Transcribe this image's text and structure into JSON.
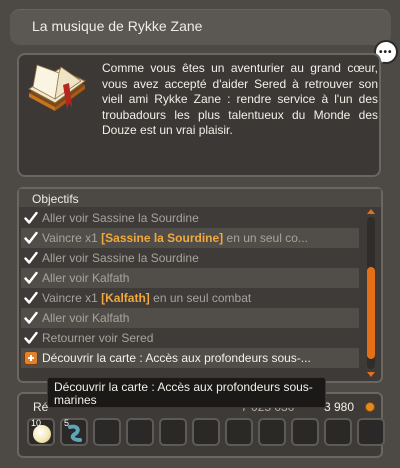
{
  "quest": {
    "title": "La musique de Rykke Zane",
    "description": "Comme vous êtes un aventurier au grand cœur, vous avez accepté d'aider Sered à retrouver son vieil ami Rykke Zane : rendre service à l'un des troubadours les plus talentueux du Monde des Douze est un vrai plaisir."
  },
  "objectives": {
    "header": "Objectifs",
    "items": [
      {
        "before": "Aller voir Sassine la Sourdine",
        "highlight": "",
        "after": "",
        "done": true
      },
      {
        "before": "Vaincre x1 ",
        "highlight": "[Sassine la Sourdine]",
        "after": " en un seul co...",
        "done": true
      },
      {
        "before": "Aller voir Sassine la Sourdine",
        "highlight": "",
        "after": "",
        "done": true
      },
      {
        "before": "Aller voir Kalfath",
        "highlight": "",
        "after": "",
        "done": true
      },
      {
        "before": "Vaincre x1 ",
        "highlight": "[Kalfath]",
        "after": " en un seul combat",
        "done": true
      },
      {
        "before": "Aller voir Kalfath",
        "highlight": "",
        "after": "",
        "done": true
      },
      {
        "before": "Retourner voir Sered",
        "highlight": "",
        "after": "",
        "done": true
      },
      {
        "before": "Découvrir la carte : Accès aux profondeurs sous-...",
        "highlight": "",
        "after": "",
        "done": false
      }
    ]
  },
  "rewards": {
    "label": "Ré",
    "xp": "7 025 030",
    "kamas": "3 980",
    "slots": [
      {
        "count": "10",
        "item": "orb"
      },
      {
        "count": "5",
        "item": "leech"
      },
      {
        "count": "",
        "item": ""
      },
      {
        "count": "",
        "item": ""
      },
      {
        "count": "",
        "item": ""
      },
      {
        "count": "",
        "item": ""
      },
      {
        "count": "",
        "item": ""
      },
      {
        "count": "",
        "item": ""
      },
      {
        "count": "",
        "item": ""
      },
      {
        "count": "",
        "item": ""
      },
      {
        "count": "",
        "item": ""
      }
    ]
  },
  "tooltip": {
    "text": "Découvrir la carte : Accès aux profondeurs sous-marines"
  },
  "colors": {
    "accent": "#e36f17",
    "highlight": "#f2a83a",
    "done_text": "#a7a39c"
  },
  "icons": {
    "quest": "book-icon",
    "done": "check-icon",
    "pending": "plus-icon",
    "chat": "chat-bubble-icon",
    "kamas": "kamas-icon"
  },
  "scroll": {
    "position": 0.62
  }
}
